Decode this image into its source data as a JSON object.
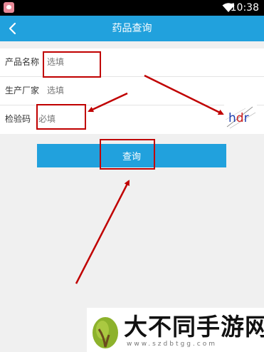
{
  "status_bar": {
    "time": "10:38",
    "app_icon": "app-icon",
    "wifi_icon": "wifi-icon"
  },
  "header": {
    "title": "药品查询",
    "back_icon": "chevron-left-icon"
  },
  "form": {
    "rows": [
      {
        "label": "产品名称",
        "placeholder": "选填"
      },
      {
        "label": "生产厂家",
        "placeholder": "选填"
      },
      {
        "label": "检验码",
        "placeholder": "必填"
      }
    ],
    "captcha": {
      "text": "hdr",
      "colors": [
        "#1f3fb0",
        "#d02020",
        "#1f3fb0"
      ]
    }
  },
  "query_button": {
    "label": "查询"
  },
  "annotation_color": "#c00000",
  "watermark": {
    "brand": "大不同手游网",
    "url": "www.szdbtgg.com"
  },
  "colors": {
    "accent": "#21a1dd",
    "background": "#f0f0f0"
  }
}
